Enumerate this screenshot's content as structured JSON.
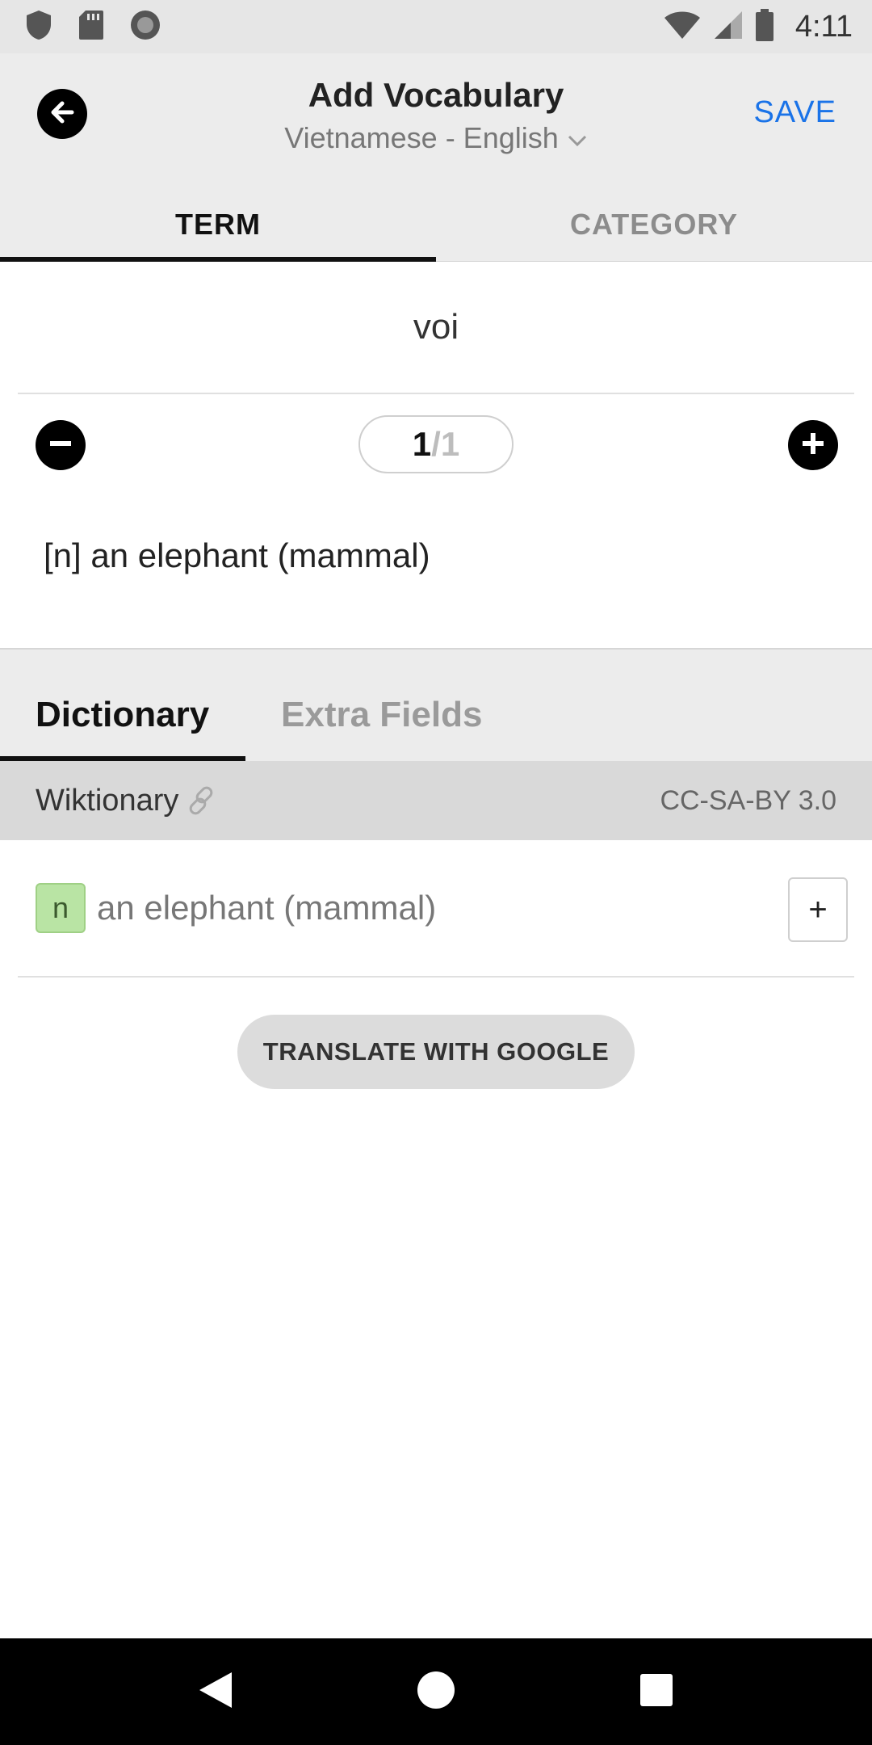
{
  "status_bar": {
    "time": "4:11",
    "icons": [
      "shield-icon",
      "sd-card-icon",
      "record-icon",
      "wifi-icon",
      "signal-icon",
      "battery-icon"
    ]
  },
  "header": {
    "title": "Add Vocabulary",
    "language_pair": "Vietnamese - English",
    "save_label": "SAVE"
  },
  "tabs": [
    {
      "label": "TERM",
      "active": true
    },
    {
      "label": "CATEGORY",
      "active": false
    }
  ],
  "term": {
    "value": "voi",
    "pager_current": "1",
    "pager_total": "/1",
    "definition": "[n] an elephant (mammal)"
  },
  "section_tabs": [
    {
      "label": "Dictionary",
      "active": true
    },
    {
      "label": "Extra Fields",
      "active": false
    }
  ],
  "source": {
    "name": "Wiktionary",
    "license": "CC-SA-BY 3.0"
  },
  "entries": [
    {
      "pos": "n",
      "text": "an elephant (mammal)",
      "add_label": "+"
    }
  ],
  "google_button": "TRANSLATE WITH GOOGLE",
  "colors": {
    "accent": "#1a73e8",
    "pos_badge": "#b9e4a4",
    "header_bg": "#ececec",
    "source_bar_bg": "#d9d9d9"
  }
}
